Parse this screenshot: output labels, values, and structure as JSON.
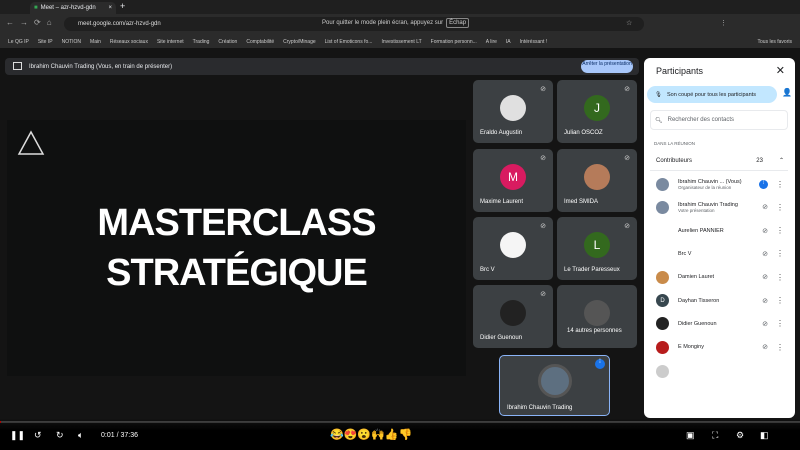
{
  "browser": {
    "tab_title": "Meet – azr-hzvd-gdn",
    "url": "meet.google.com/azr-hzvd-gdn",
    "fullscreen_msg": "Pour quitter le mode plein écran, appuyez sur",
    "esc_key": "Échap",
    "bookmarks": [
      "Le QG IP",
      "Site IP",
      "NOTION",
      "Main",
      "Réseaux sociaux",
      "Site internet",
      "Trading",
      "Création",
      "Comptabilité",
      "Crypto/Minage",
      "List of Emoticons fo...",
      "Investissement LT",
      "Formation personn...",
      "A lire",
      "IA",
      "Intéréssant !"
    ],
    "all_bookmarks": "Tous les favoris"
  },
  "banner": {
    "text": "Ibrahim Chauvin Trading (Vous, en train de présenter)",
    "stop_button": "Arrêter la présentation"
  },
  "slide": {
    "line1": "MASTERCLASS",
    "line2": "STRATÉGIQUE"
  },
  "tiles": [
    {
      "name": "Eraldo Augustin",
      "initial": "",
      "color": "#e0e0e0"
    },
    {
      "name": "Julian OSCOZ",
      "initial": "J",
      "color": "#33691e"
    },
    {
      "name": "Maxime Laurent",
      "initial": "M",
      "color": "#d81b60"
    },
    {
      "name": "Imed SMIDA",
      "initial": "",
      "color": "#b57b5a"
    },
    {
      "name": "Brc V",
      "initial": "",
      "color": "#f5f5f5"
    },
    {
      "name": "Le Trader Paresseux",
      "initial": "L",
      "color": "#33691e"
    },
    {
      "name": "Didier Guenoun",
      "initial": "",
      "color": "#222"
    },
    {
      "name": "14 autres personnes",
      "initial": "",
      "color": "#555"
    }
  ],
  "self_tile": {
    "name": "Ibrahim Chauvin Trading"
  },
  "panel": {
    "title": "Participants",
    "mute_all": "Son coupé pour tous les participants",
    "search_placeholder": "Rechercher des contacts",
    "section": "DANS LA RÉUNION",
    "group": "Contributeurs",
    "count": "23",
    "people": [
      {
        "name": "Ibrahim Chauvin ... (Vous)",
        "sub": "Organisateur de la réunion",
        "color": "#7a8aa0"
      },
      {
        "name": "Ibrahim Chauvin Trading",
        "sub": "Votre présentation",
        "color": "#7a8aa0"
      },
      {
        "name": "Aurelien PANNIER",
        "sub": "",
        "color": "#fff"
      },
      {
        "name": "Brc V",
        "sub": "",
        "color": "#fff"
      },
      {
        "name": "Damien Lauret",
        "sub": "",
        "color": "#c98b4a"
      },
      {
        "name": "Dayhan Tisseron",
        "sub": "",
        "color": "#37474f",
        "initial": "D"
      },
      {
        "name": "Didier Guenoun",
        "sub": "",
        "color": "#222"
      },
      {
        "name": "E Monginy",
        "sub": "",
        "color": "#b71c1c"
      }
    ]
  },
  "player": {
    "time": "0:01 / 37:36",
    "progress": 0.0004
  }
}
